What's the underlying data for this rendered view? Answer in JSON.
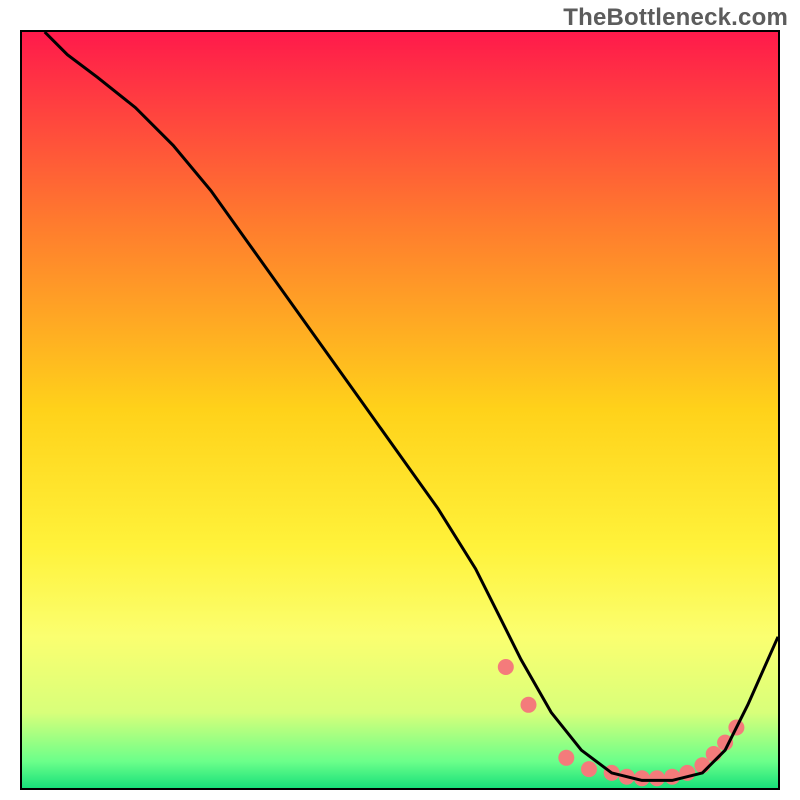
{
  "watermark": "TheBottleneck.com",
  "chart_data": {
    "type": "line",
    "title": "",
    "xlabel": "",
    "ylabel": "",
    "xlim": [
      0,
      100
    ],
    "ylim": [
      0,
      100
    ],
    "grid": false,
    "legend": false,
    "gradient_stops": [
      {
        "pos": 0.0,
        "color": "#ff1a4b"
      },
      {
        "pos": 0.25,
        "color": "#ff7a2e"
      },
      {
        "pos": 0.5,
        "color": "#ffd21a"
      },
      {
        "pos": 0.68,
        "color": "#fff23a"
      },
      {
        "pos": 0.8,
        "color": "#fbff70"
      },
      {
        "pos": 0.9,
        "color": "#d8ff7a"
      },
      {
        "pos": 0.965,
        "color": "#6bff8a"
      },
      {
        "pos": 1.0,
        "color": "#18e07a"
      }
    ],
    "series": [
      {
        "name": "bottleneck-curve",
        "color": "#000000",
        "x": [
          3,
          6,
          10,
          15,
          20,
          25,
          30,
          35,
          40,
          45,
          50,
          55,
          60,
          63,
          66,
          70,
          74,
          78,
          82,
          86,
          90,
          93,
          96,
          100
        ],
        "y": [
          100,
          97,
          94,
          90,
          85,
          79,
          72,
          65,
          58,
          51,
          44,
          37,
          29,
          23,
          17,
          10,
          5,
          2,
          1,
          1,
          2,
          5,
          11,
          20
        ]
      }
    ],
    "dots": {
      "color": "#f47b7b",
      "radius": 8,
      "points": [
        {
          "x": 64,
          "y": 16
        },
        {
          "x": 67,
          "y": 11
        },
        {
          "x": 72,
          "y": 4
        },
        {
          "x": 75,
          "y": 2.5
        },
        {
          "x": 78,
          "y": 2
        },
        {
          "x": 80,
          "y": 1.5
        },
        {
          "x": 82,
          "y": 1.3
        },
        {
          "x": 84,
          "y": 1.3
        },
        {
          "x": 86,
          "y": 1.5
        },
        {
          "x": 88,
          "y": 2
        },
        {
          "x": 90,
          "y": 3
        },
        {
          "x": 91.5,
          "y": 4.5
        },
        {
          "x": 93,
          "y": 6
        },
        {
          "x": 94.5,
          "y": 8
        }
      ]
    }
  }
}
